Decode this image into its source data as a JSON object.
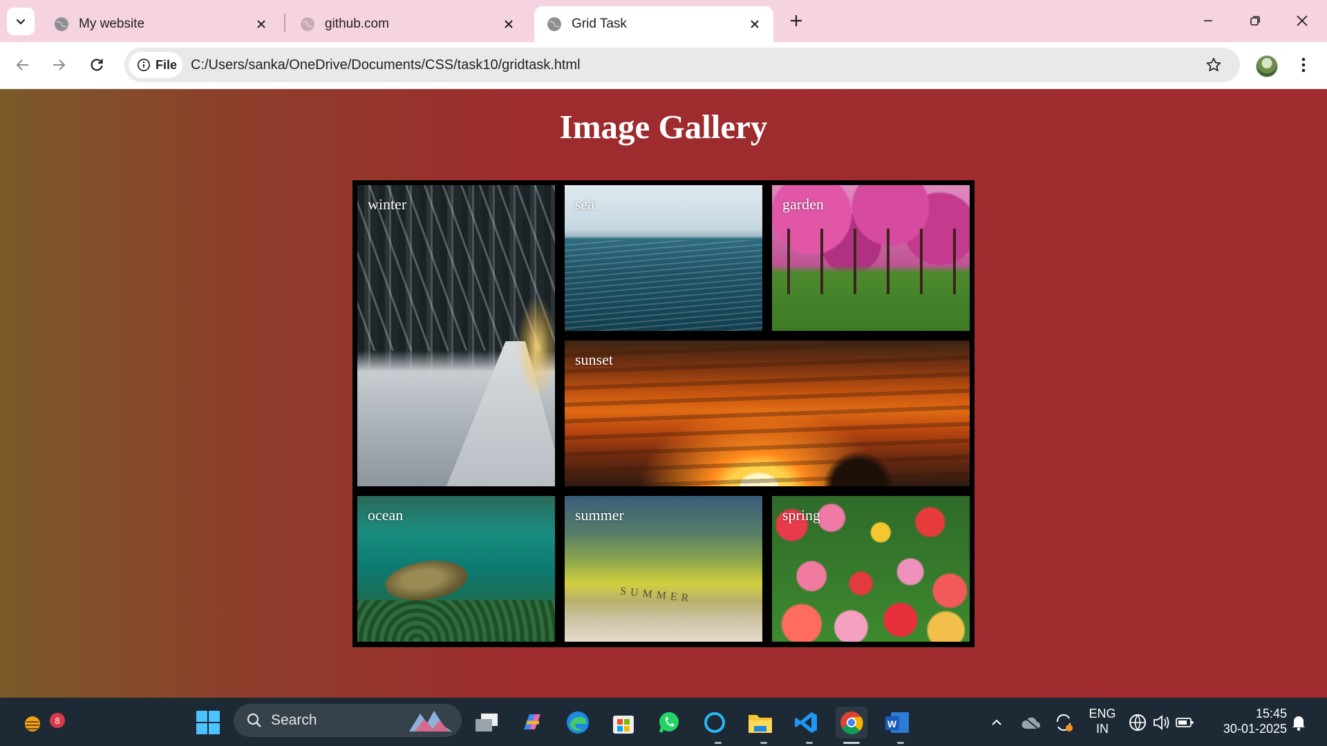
{
  "browser": {
    "tabs": [
      {
        "title": "My website",
        "active": false
      },
      {
        "title": "github.com",
        "active": false
      },
      {
        "title": "Grid Task",
        "active": true
      }
    ],
    "omnibox": {
      "chip_label": "File",
      "url": "C:/Users/sanka/OneDrive/Documents/CSS/task10/gridtask.html"
    }
  },
  "page": {
    "heading": "Image Gallery",
    "images": [
      {
        "caption": "winter"
      },
      {
        "caption": "sea"
      },
      {
        "caption": "garden"
      },
      {
        "caption": "sunset"
      },
      {
        "caption": "ocean"
      },
      {
        "caption": "summer"
      },
      {
        "caption": "spring"
      }
    ],
    "summer_tiles": "SUMMER"
  },
  "taskbar": {
    "widgets_badge": "8",
    "search_label": "Search",
    "language": "ENG",
    "region": "IN",
    "time": "15:45",
    "date": "30-01-2025"
  },
  "colors": {
    "tabstrip": "#f6d3e1",
    "page_gradient_left": "#7b5a29",
    "page_gradient_right": "#a02c30",
    "taskbar": "#1d2a35"
  }
}
